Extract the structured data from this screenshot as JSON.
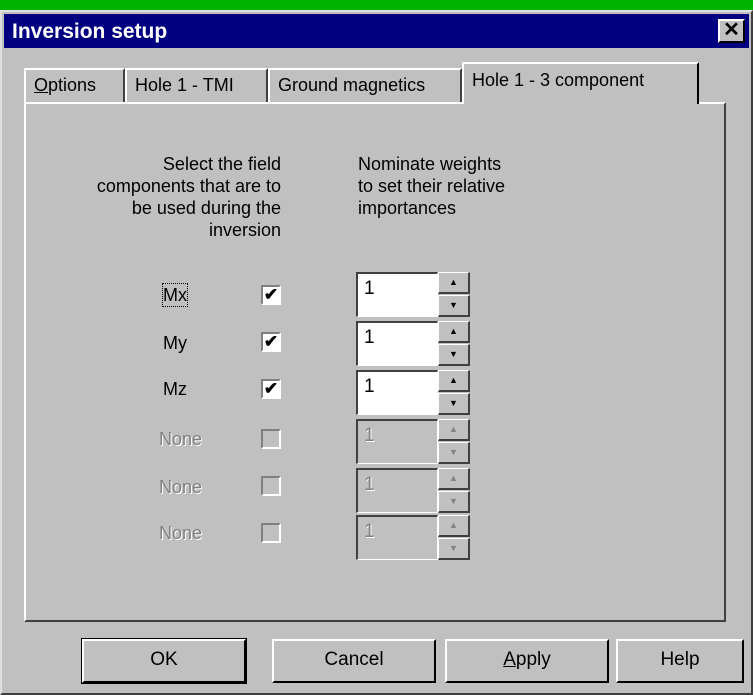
{
  "window": {
    "title": "Inversion setup",
    "close_glyph": "✕"
  },
  "tabs": [
    {
      "label_underlined": "O",
      "label_rest": "ptions",
      "label": "Options",
      "active": false
    },
    {
      "label": "Hole 1 - TMI",
      "active": false
    },
    {
      "label": "Ground magnetics",
      "active": false
    },
    {
      "label": "Hole 1 - 3 component",
      "active": true
    }
  ],
  "section": {
    "left_header": [
      "Select the field",
      "components that are to",
      "be used during the",
      "inversion"
    ],
    "right_header": [
      "Nominate weights",
      "to set their relative",
      "importances"
    ]
  },
  "components": [
    {
      "name": "Mx",
      "checked": true,
      "enabled": true,
      "weight": "1"
    },
    {
      "name": "My",
      "checked": true,
      "enabled": true,
      "weight": "1"
    },
    {
      "name": "Mz",
      "checked": true,
      "enabled": true,
      "weight": "1"
    },
    {
      "name": "None",
      "checked": false,
      "enabled": false,
      "weight": "1"
    },
    {
      "name": "None",
      "checked": false,
      "enabled": false,
      "weight": "1"
    },
    {
      "name": "None",
      "checked": false,
      "enabled": false,
      "weight": "1"
    }
  ],
  "check_glyph": "✔",
  "buttons": {
    "ok": "OK",
    "cancel": "Cancel",
    "apply_underlined": "A",
    "apply_rest": "pply",
    "help": "Help"
  }
}
